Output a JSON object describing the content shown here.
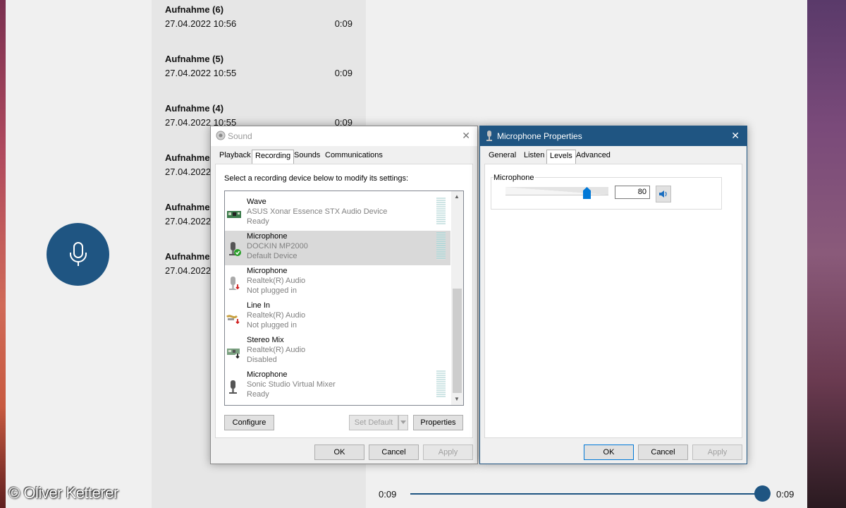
{
  "recorder": {
    "recordings": [
      {
        "title": "Aufnahme (6)",
        "date": "27.04.2022 10:56",
        "duration": "0:09"
      },
      {
        "title": "Aufnahme (5)",
        "date": "27.04.2022 10:55",
        "duration": "0:09"
      },
      {
        "title": "Aufnahme (4)",
        "date": "27.04.2022 10:55",
        "duration": "0:09"
      },
      {
        "title": "Aufnahme",
        "date": "27.04.2022",
        "duration": ""
      },
      {
        "title": "Aufnahme",
        "date": "27.04.2022",
        "duration": ""
      },
      {
        "title": "Aufnahme",
        "date": "27.04.2022",
        "duration": ""
      }
    ],
    "playback": {
      "elapsed": "0:09",
      "total": "0:09",
      "progress": 1.0
    },
    "accent_color": "#1f5582",
    "record_icon": "microphone-icon"
  },
  "sound_dialog": {
    "title": "Sound",
    "close": "✕",
    "tabs": [
      "Playback",
      "Recording",
      "Sounds",
      "Communications"
    ],
    "active_tab": "Recording",
    "instruction": "Select a recording device below to modify its settings:",
    "devices": [
      {
        "name": "Wave",
        "driver": "ASUS Xonar Essence STX Audio Device",
        "status": "Ready",
        "icon": "sound-card-icon",
        "selected": false,
        "meter": true
      },
      {
        "name": "Microphone",
        "driver": "DOCKIN MP2000",
        "status": "Default Device",
        "icon": "microphone-default-icon",
        "selected": true,
        "meter": true
      },
      {
        "name": "Microphone",
        "driver": "Realtek(R) Audio",
        "status": "Not plugged in",
        "icon": "microphone-unplugged-icon",
        "selected": false,
        "meter": false
      },
      {
        "name": "Line In",
        "driver": "Realtek(R) Audio",
        "status": "Not plugged in",
        "icon": "line-in-icon",
        "selected": false,
        "meter": false
      },
      {
        "name": "Stereo Mix",
        "driver": "Realtek(R) Audio",
        "status": "Disabled",
        "icon": "sound-card-disabled-icon",
        "selected": false,
        "meter": false
      },
      {
        "name": "Microphone",
        "driver": "Sonic Studio Virtual Mixer",
        "status": "Ready",
        "icon": "microphone-icon",
        "selected": false,
        "meter": true
      }
    ],
    "buttons": {
      "configure": "Configure",
      "set_default": "Set Default",
      "properties": "Properties",
      "ok": "OK",
      "cancel": "Cancel",
      "apply": "Apply"
    }
  },
  "mic_dialog": {
    "title": "Microphone Properties",
    "close": "✕",
    "tabs": [
      "General",
      "Listen",
      "Levels",
      "Advanced"
    ],
    "active_tab": "Levels",
    "group_label": "Microphone",
    "level": "80",
    "level_fraction": 0.8,
    "buttons": {
      "ok": "OK",
      "cancel": "Cancel",
      "apply": "Apply"
    }
  },
  "watermark": "© Oliver Ketterer"
}
